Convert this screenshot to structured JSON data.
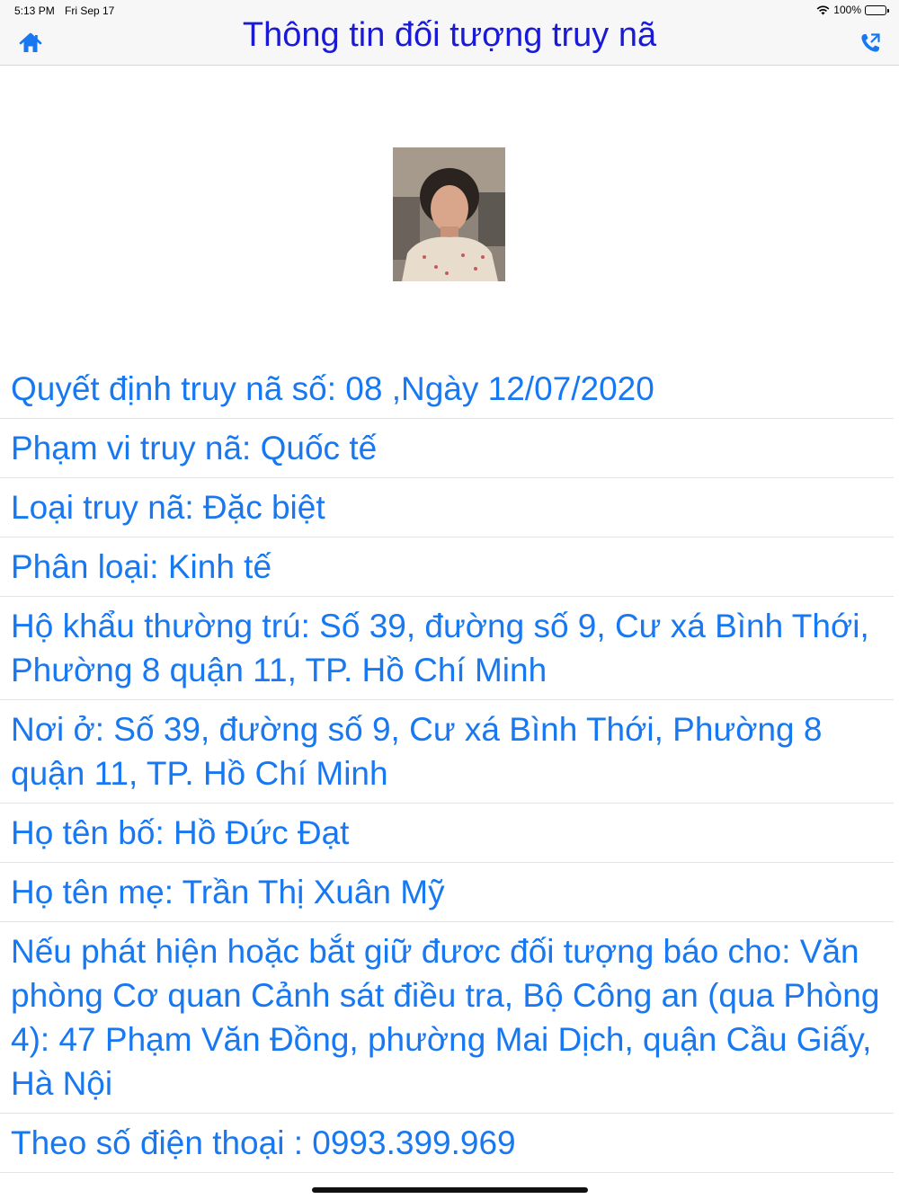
{
  "status_bar": {
    "time": "5:13 PM",
    "date": "Fri Sep 17",
    "battery": "100%",
    "battery_level": 1.0
  },
  "nav": {
    "title": "Thông tin đối tượng truy nã",
    "left_icon": "home-icon",
    "right_icon": "phone-call-icon"
  },
  "colors": {
    "title": "#1a1ad6",
    "text": "#1778f2",
    "icon": "#1778f2"
  },
  "info": [
    "Quyết định truy nã số: 08 ,Ngày 12/07/2020",
    "Phạm vi truy nã: Quốc tế",
    "Loại truy nã: Đặc biệt",
    "Phân loại:  Kinh tế",
    "Hộ khẩu thường trú:  Số 39, đường số 9, Cư xá Bình Thới, Phường 8 quận 11, TP. Hồ Chí Minh",
    "Nơi ở: Số 39, đường số 9, Cư xá Bình Thới, Phường 8 quận 11, TP. Hồ Chí Minh",
    "Họ tên bố: Hồ Đức Đạt",
    "Họ tên mẹ: Trần Thị Xuân Mỹ",
    "Nếu phát hiện hoặc bắt giữ đươc đối tượng báo cho: Văn phòng Cơ quan Cảnh sát điều tra, Bộ Công an (qua Phòng 4): 47 Phạm Văn Đồng, phường Mai Dịch, quận Cầu Giấy, Hà Nội",
    "Theo số điện thoại : 0993.399.969"
  ]
}
